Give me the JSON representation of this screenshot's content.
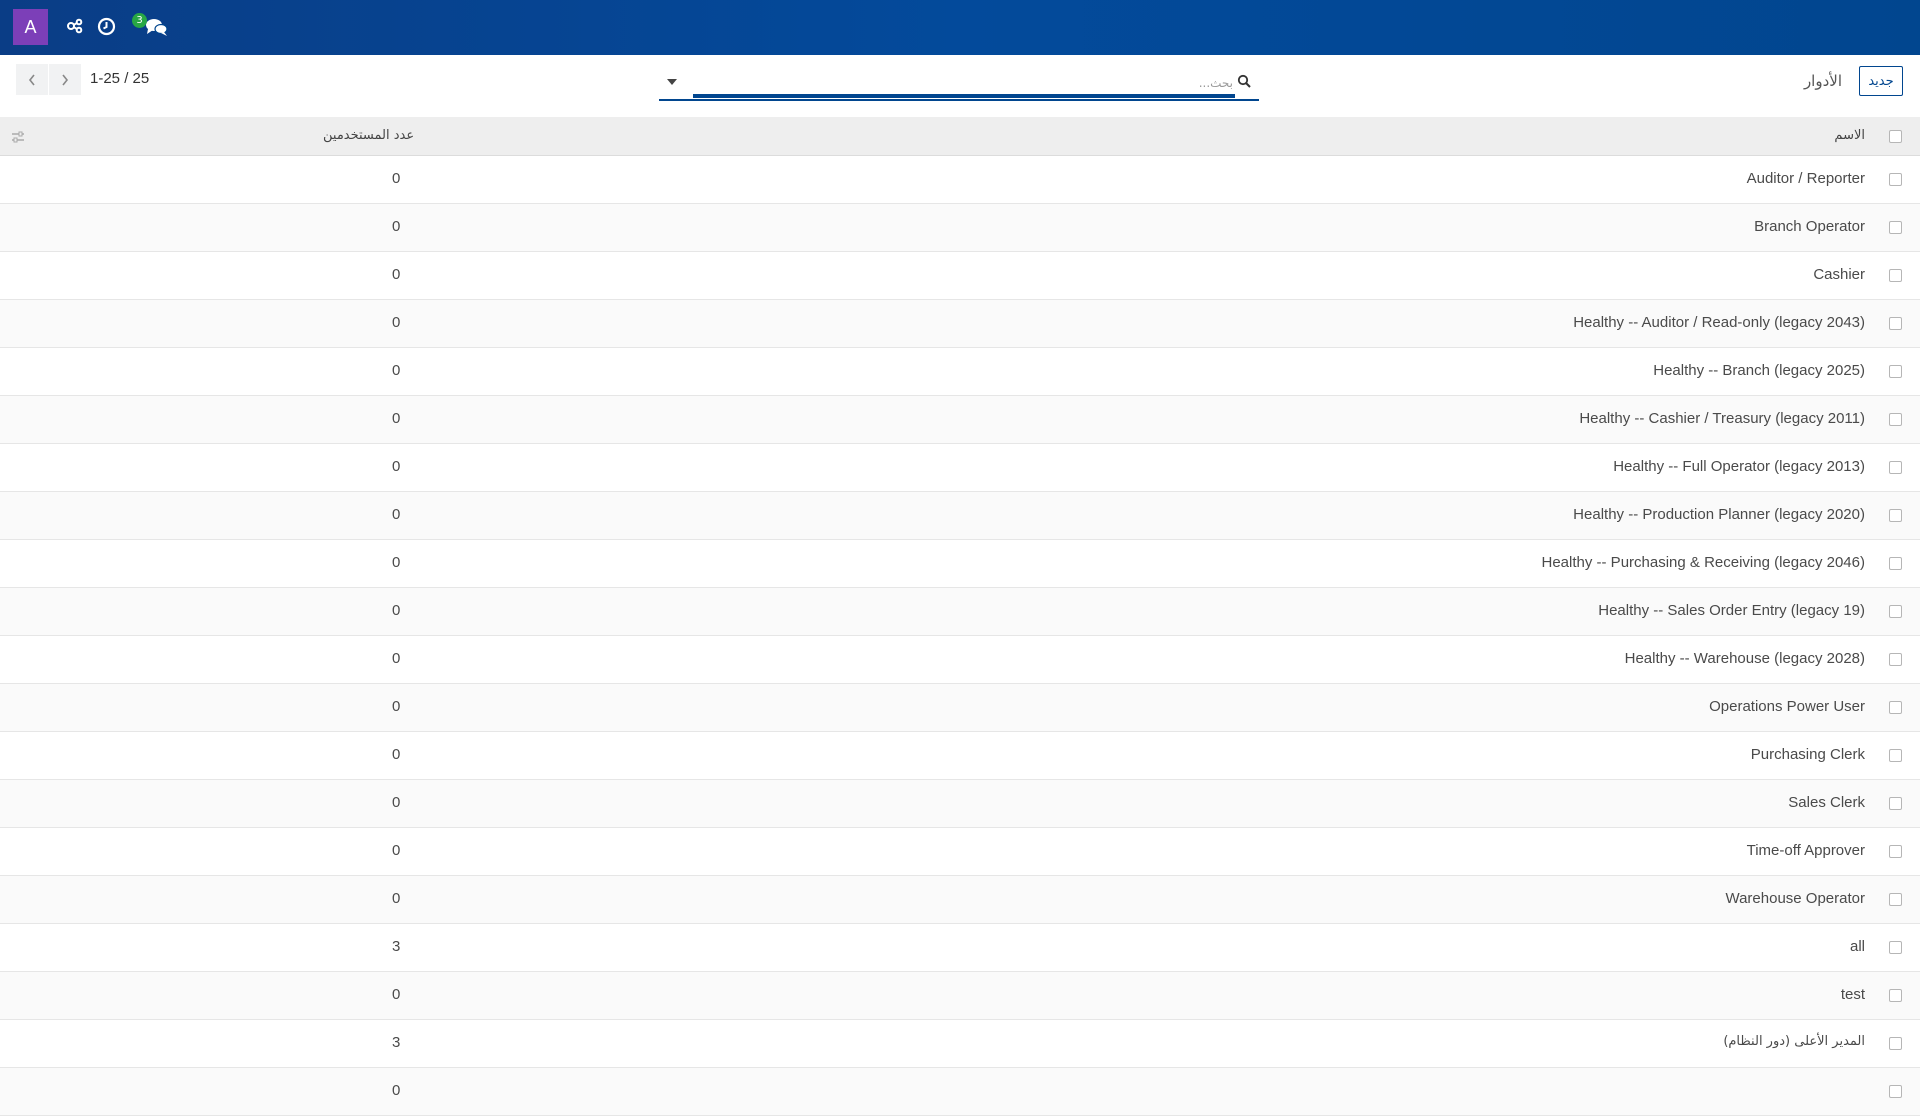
{
  "navbar": {
    "avatar_letter": "A",
    "icons": [
      "share-nodes-icon",
      "clock-icon",
      "chat-icon"
    ],
    "chat_badge": "3",
    "colors": {
      "navbar": "#01468f",
      "avatar": "#7c3fb8",
      "badge": "#28a745"
    }
  },
  "control_panel": {
    "new_button": "جديد",
    "breadcrumb": "الأدوار",
    "search_placeholder": "بحث...",
    "pager": "1-25 / 25"
  },
  "table": {
    "headers": {
      "name": "الاسم",
      "users": "عدد المستخدمين"
    },
    "rows": [
      {
        "name": "Auditor / Reporter",
        "users": "0"
      },
      {
        "name": "Branch Operator",
        "users": "0"
      },
      {
        "name": "Cashier",
        "users": "0"
      },
      {
        "name": "Healthy -- Auditor / Read-only (legacy 2043)",
        "users": "0"
      },
      {
        "name": "Healthy -- Branch (legacy 2025)",
        "users": "0"
      },
      {
        "name": "Healthy -- Cashier / Treasury (legacy 2011)",
        "users": "0"
      },
      {
        "name": "Healthy -- Full Operator (legacy 2013)",
        "users": "0"
      },
      {
        "name": "Healthy -- Production Planner (legacy 2020)",
        "users": "0"
      },
      {
        "name": "Healthy -- Purchasing & Receiving (legacy 2046)",
        "users": "0"
      },
      {
        "name": "Healthy -- Sales Order Entry (legacy 19)",
        "users": "0"
      },
      {
        "name": "Healthy -- Warehouse (legacy 2028)",
        "users": "0"
      },
      {
        "name": "Operations Power User",
        "users": "0"
      },
      {
        "name": "Purchasing Clerk",
        "users": "0"
      },
      {
        "name": "Sales Clerk",
        "users": "0"
      },
      {
        "name": "Time-off Approver",
        "users": "0"
      },
      {
        "name": "Warehouse Operator",
        "users": "0"
      },
      {
        "name": "all",
        "users": "3"
      },
      {
        "name": "test",
        "users": "0"
      },
      {
        "name": "المدير الأعلى (دور النظام)",
        "users": "3"
      },
      {
        "name": "",
        "users": "0"
      }
    ]
  }
}
